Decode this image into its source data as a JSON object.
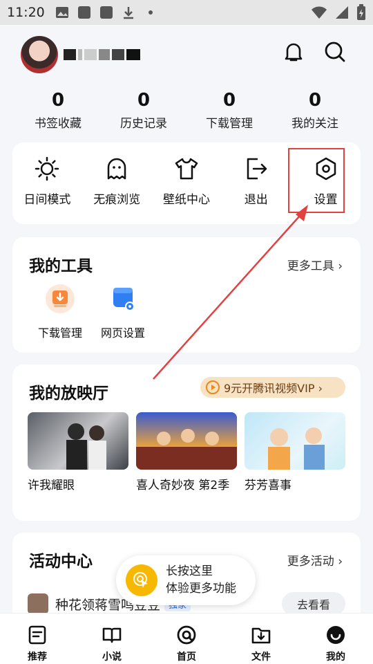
{
  "status_bar": {
    "time": "11:20"
  },
  "header": {
    "username_display": ""
  },
  "stats": [
    {
      "value": "0",
      "label": "书签收藏"
    },
    {
      "value": "0",
      "label": "历史记录"
    },
    {
      "value": "0",
      "label": "下载管理"
    },
    {
      "value": "0",
      "label": "我的关注"
    }
  ],
  "quick_actions": [
    {
      "label": "日间模式",
      "icon": "sun-icon"
    },
    {
      "label": "无痕浏览",
      "icon": "ghost-icon"
    },
    {
      "label": "壁纸中心",
      "icon": "shirt-icon"
    },
    {
      "label": "退出",
      "icon": "exit-icon"
    },
    {
      "label": "设置",
      "icon": "settings-icon"
    }
  ],
  "tools": {
    "title": "我的工具",
    "more": "更多工具 ›",
    "items": [
      {
        "label": "下载管理",
        "icon": "download-icon"
      },
      {
        "label": "网页设置",
        "icon": "web-settings-icon"
      }
    ]
  },
  "theater": {
    "title": "我的放映厅",
    "vip": "9元开腾讯视频VIP ›",
    "items": [
      {
        "title": "许我耀眼"
      },
      {
        "title": "喜人奇妙夜 第2季"
      },
      {
        "title": "芬芳喜事"
      }
    ]
  },
  "activity": {
    "title": "活动中心",
    "more": "更多活动 ›",
    "row_text": "种花领蒋雪鸣豆豆",
    "row_tag": "独家",
    "row_button": "去看看"
  },
  "tooltip": {
    "line1": "长按这里",
    "line2": "体验更多功能"
  },
  "bottom_nav": [
    {
      "label": "推荐",
      "icon": "recommend-icon"
    },
    {
      "label": "小说",
      "icon": "book-icon"
    },
    {
      "label": "首页",
      "icon": "home-icon"
    },
    {
      "label": "文件",
      "icon": "file-icon"
    },
    {
      "label": "我的",
      "icon": "profile-icon"
    }
  ],
  "colors": {
    "highlight": "#e24141",
    "vip_bg": "#f8e2c4",
    "tip_icon": "#f6b800"
  }
}
